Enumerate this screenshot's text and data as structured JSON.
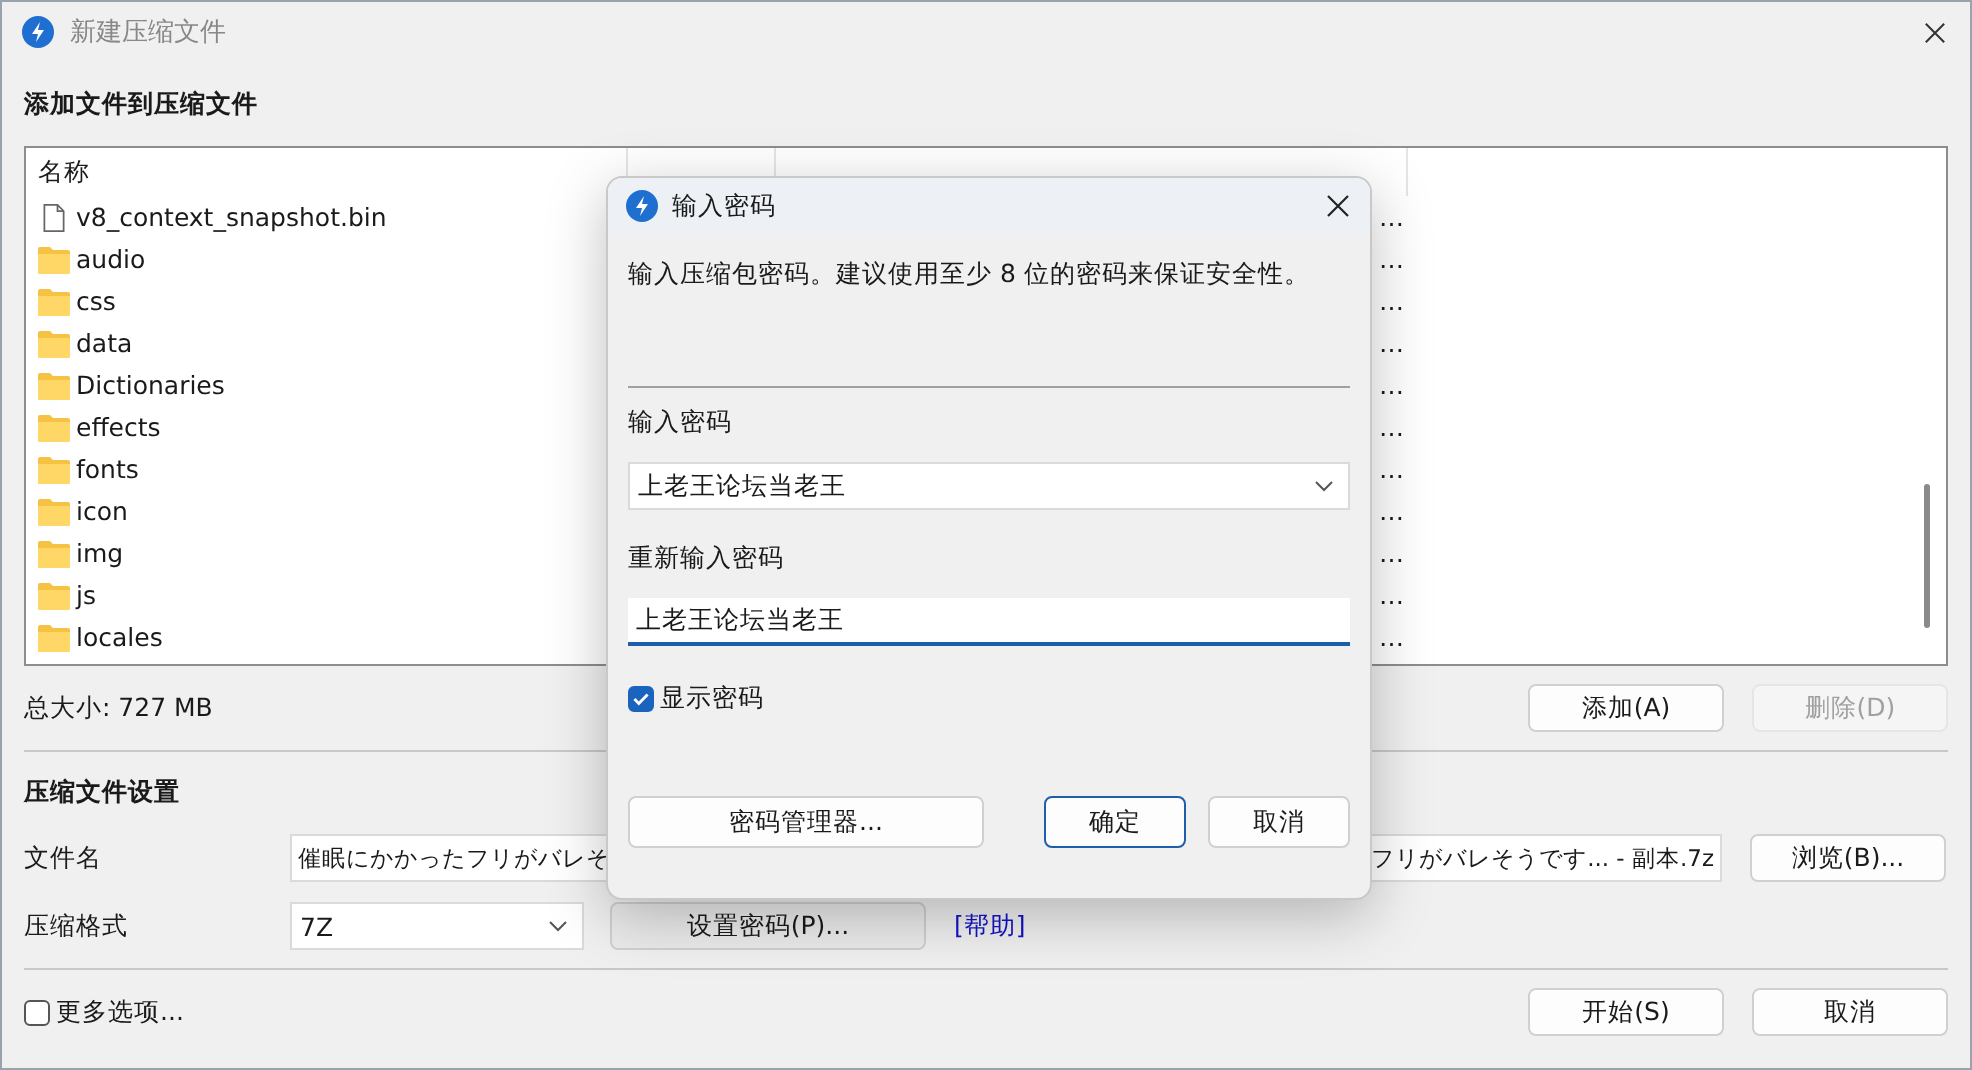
{
  "window": {
    "title": "新建压缩文件"
  },
  "files_section": {
    "heading": "添加文件到压缩文件",
    "columns": [
      "名称"
    ],
    "rows": [
      {
        "name": "v8_context_snapshot.bin",
        "kind": "file",
        "path": "…"
      },
      {
        "name": "audio",
        "kind": "folder",
        "path": "…"
      },
      {
        "name": "css",
        "kind": "folder",
        "path": "…"
      },
      {
        "name": "data",
        "kind": "folder",
        "path": "…"
      },
      {
        "name": "Dictionaries",
        "kind": "folder",
        "path": "…"
      },
      {
        "name": "effects",
        "kind": "folder",
        "path": "…"
      },
      {
        "name": "fonts",
        "kind": "folder",
        "path": "…"
      },
      {
        "name": "icon",
        "kind": "folder",
        "path": "…"
      },
      {
        "name": "img",
        "kind": "folder",
        "path": "…"
      },
      {
        "name": "js",
        "kind": "folder",
        "path": "…"
      },
      {
        "name": "locales",
        "kind": "folder",
        "path": "…"
      }
    ],
    "total": "总大小: 727 MB",
    "buttons": [
      {
        "label": "添加(A)",
        "disabled": false
      },
      {
        "label": "删除(D)",
        "disabled": true
      }
    ]
  },
  "settings": {
    "heading": "压缩文件设置",
    "filename": {
      "label": "文件名",
      "value_start": "催眠にかかったフリがバレそ",
      "value_end": "フリがバレそうです... - 副本.7z"
    },
    "browse_button": "浏览(B)...",
    "format": {
      "label": "压缩格式",
      "value": "7Z"
    },
    "password_button": "设置密码(P)...",
    "help_link": "[帮助]"
  },
  "footer": {
    "more_options": {
      "label": "更多选项...",
      "checked": false
    },
    "buttons": [
      "开始(S)",
      "取消"
    ]
  },
  "password_dialog": {
    "title": "输入密码",
    "message": "输入压缩包密码。建议使用至少 8 位的密码来保证安全性。",
    "password": {
      "label": "输入密码",
      "value": "上老王论坛当老王"
    },
    "confirm": {
      "label": "重新输入密码",
      "value": "上老王论坛当老王"
    },
    "show_password": {
      "label": "显示密码",
      "checked": true
    },
    "buttons": [
      {
        "label": "密码管理器...",
        "default": false
      },
      {
        "label": "确定",
        "default": true
      },
      {
        "label": "取消",
        "default": false
      }
    ]
  }
}
